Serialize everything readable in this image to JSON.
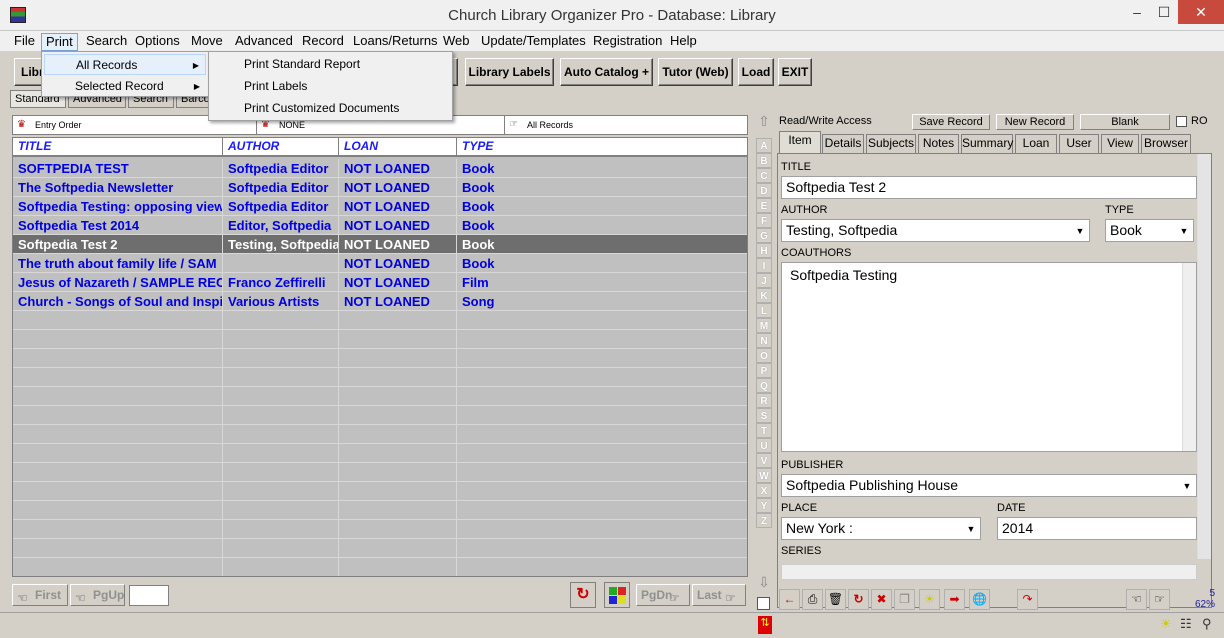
{
  "window": {
    "title": "Church Library Organizer Pro - Database: Library",
    "minimize": "–",
    "maximize": "☐",
    "close": "✕"
  },
  "menu": [
    "File",
    "Print",
    "Search",
    "Options",
    "Move",
    "Advanced",
    "Record",
    "Loans/Returns",
    "Web",
    "Update/Templates",
    "Registration",
    "Help"
  ],
  "print_menu": {
    "items": [
      "All Records",
      "Selected Record"
    ],
    "submenu": [
      "Print Standard Report",
      "Print Labels",
      "Print Customized Documents"
    ]
  },
  "toolbar": {
    "partial_left": "Libr",
    "buttons": [
      "Library Labels",
      "Auto Catalog +",
      "Tutor (Web)",
      "Load",
      "EXIT"
    ]
  },
  "mode_tabs": [
    "Standard",
    "Advanced",
    "Search",
    "Barco"
  ],
  "filter": {
    "order": "Entry Order",
    "filter": "NONE",
    "records": "All Records"
  },
  "grid": {
    "headers": [
      "TITLE",
      "AUTHOR",
      "LOAN",
      "TYPE"
    ],
    "rows": [
      [
        "SOFTPEDIA TEST",
        "Softpedia Editor",
        "NOT LOANED",
        "Book"
      ],
      [
        "The Softpedia Newsletter",
        "Softpedia Editor",
        "NOT LOANED",
        "Book"
      ],
      [
        "Softpedia Testing: opposing view",
        "Softpedia Editor",
        "NOT LOANED",
        "Book"
      ],
      [
        "Softpedia Test 2014",
        "Editor, Softpedia",
        "NOT LOANED",
        "Book"
      ],
      [
        "Softpedia Test 2",
        "Testing, Softpedia",
        "NOT LOANED",
        "Book"
      ],
      [
        "The truth about family life / SAM",
        "",
        "NOT LOANED",
        "Book"
      ],
      [
        "Jesus of Nazareth / SAMPLE REC",
        "Franco Zeffirelli",
        "NOT LOANED",
        "Film"
      ],
      [
        "Church - Songs of Soul and Inspi",
        "Various Artists",
        "NOT LOANED",
        "Song"
      ]
    ],
    "selected_index": 4
  },
  "nav": {
    "first": "First",
    "pgup": "PgUp",
    "pgdn": "PgDn",
    "last": "Last"
  },
  "alphabet": [
    "A",
    "B",
    "C",
    "D",
    "E",
    "F",
    "G",
    "H",
    "I",
    "J",
    "K",
    "L",
    "M",
    "N",
    "O",
    "P",
    "Q",
    "R",
    "S",
    "T",
    "U",
    "V",
    "W",
    "X",
    "Y",
    "Z"
  ],
  "record_panel": {
    "access": "Read/Write Access",
    "save": "Save Record",
    "new": "New Record",
    "blank": "Blank",
    "ro": "RO",
    "tabs": [
      "Item",
      "Details",
      "Subjects",
      "Notes",
      "Summary",
      "Loan",
      "User",
      "View",
      "Browser"
    ],
    "fields": {
      "title_label": "TITLE",
      "title": "Softpedia Test 2",
      "author_label": "AUTHOR",
      "author": "Testing, Softpedia",
      "type_label": "TYPE",
      "type": "Book",
      "coauthors_label": "COAUTHORS",
      "coauthors": "Softpedia Testing",
      "publisher_label": "PUBLISHER",
      "publisher": "Softpedia Publishing House",
      "place_label": "PLACE",
      "place": "New York :",
      "date_label": "DATE",
      "date": "2014",
      "series_label": "SERIES"
    },
    "record_count": "5",
    "zoom": "62%"
  }
}
